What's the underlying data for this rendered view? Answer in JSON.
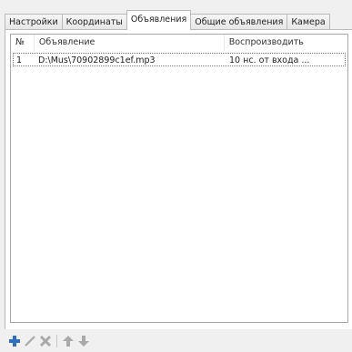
{
  "tabs": [
    {
      "label": "Настройки",
      "active": false
    },
    {
      "label": "Координаты",
      "active": false
    },
    {
      "label": "Объявления",
      "active": true
    },
    {
      "label": "Общие объявления",
      "active": false
    },
    {
      "label": "Камера",
      "active": false
    }
  ],
  "list": {
    "columns": [
      "№",
      "Объявление",
      "Воспроизводить"
    ],
    "rows": [
      {
        "num": "1",
        "announcement": "D:\\Mus\\70902899c1ef.mp3",
        "play": "10 нс. от входа ..."
      }
    ]
  },
  "toolbar": {
    "add_icon": "plus-icon",
    "edit_icon": "pencil-icon",
    "delete_icon": "x-delete-icon",
    "up_icon": "arrow-up-icon",
    "down_icon": "arrow-down-icon",
    "colors": {
      "add": "#2f6fc4",
      "disabled": "#a9a9a9"
    }
  }
}
